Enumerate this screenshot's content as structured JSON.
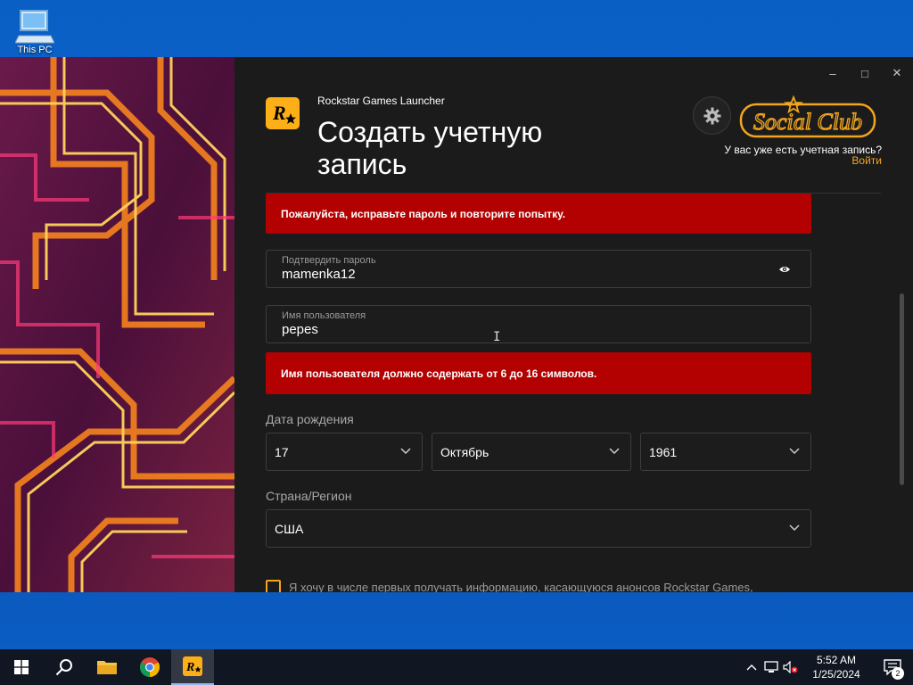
{
  "desktop": {
    "this_pc_label": "This PC"
  },
  "window": {
    "app_name": "Rockstar Games Launcher",
    "title": "Создать учетную запись",
    "controls": {
      "minimize": "–",
      "maximize": "□",
      "close": "✕"
    },
    "social_club_logo": "Social Club",
    "account_question": "У вас уже есть учетная запись?",
    "login_link": "Войти"
  },
  "form": {
    "password_error": "Пожалуйста, исправьте пароль и повторите попытку.",
    "confirm_password": {
      "label": "Подтвердить пароль",
      "value": "mamenka12"
    },
    "username": {
      "label": "Имя пользователя",
      "value": "pepes"
    },
    "username_error": "Имя пользователя должно содержать от 6 до 16 символов.",
    "birth_date_label": "Дата рождения",
    "birth_day": "17",
    "birth_month": "Октябрь",
    "birth_year": "1961",
    "country_label": "Страна/Регион",
    "country": "США",
    "newsletter_label": "Я хочу в числе первых получать информацию, касающуюся анонсов Rockstar Games,"
  },
  "taskbar": {
    "time": "5:52 AM",
    "date": "1/25/2024",
    "notification_count": "2"
  },
  "colors": {
    "accent": "#f3a51d",
    "error": "#b30000",
    "panel": "#1b1b1b"
  }
}
